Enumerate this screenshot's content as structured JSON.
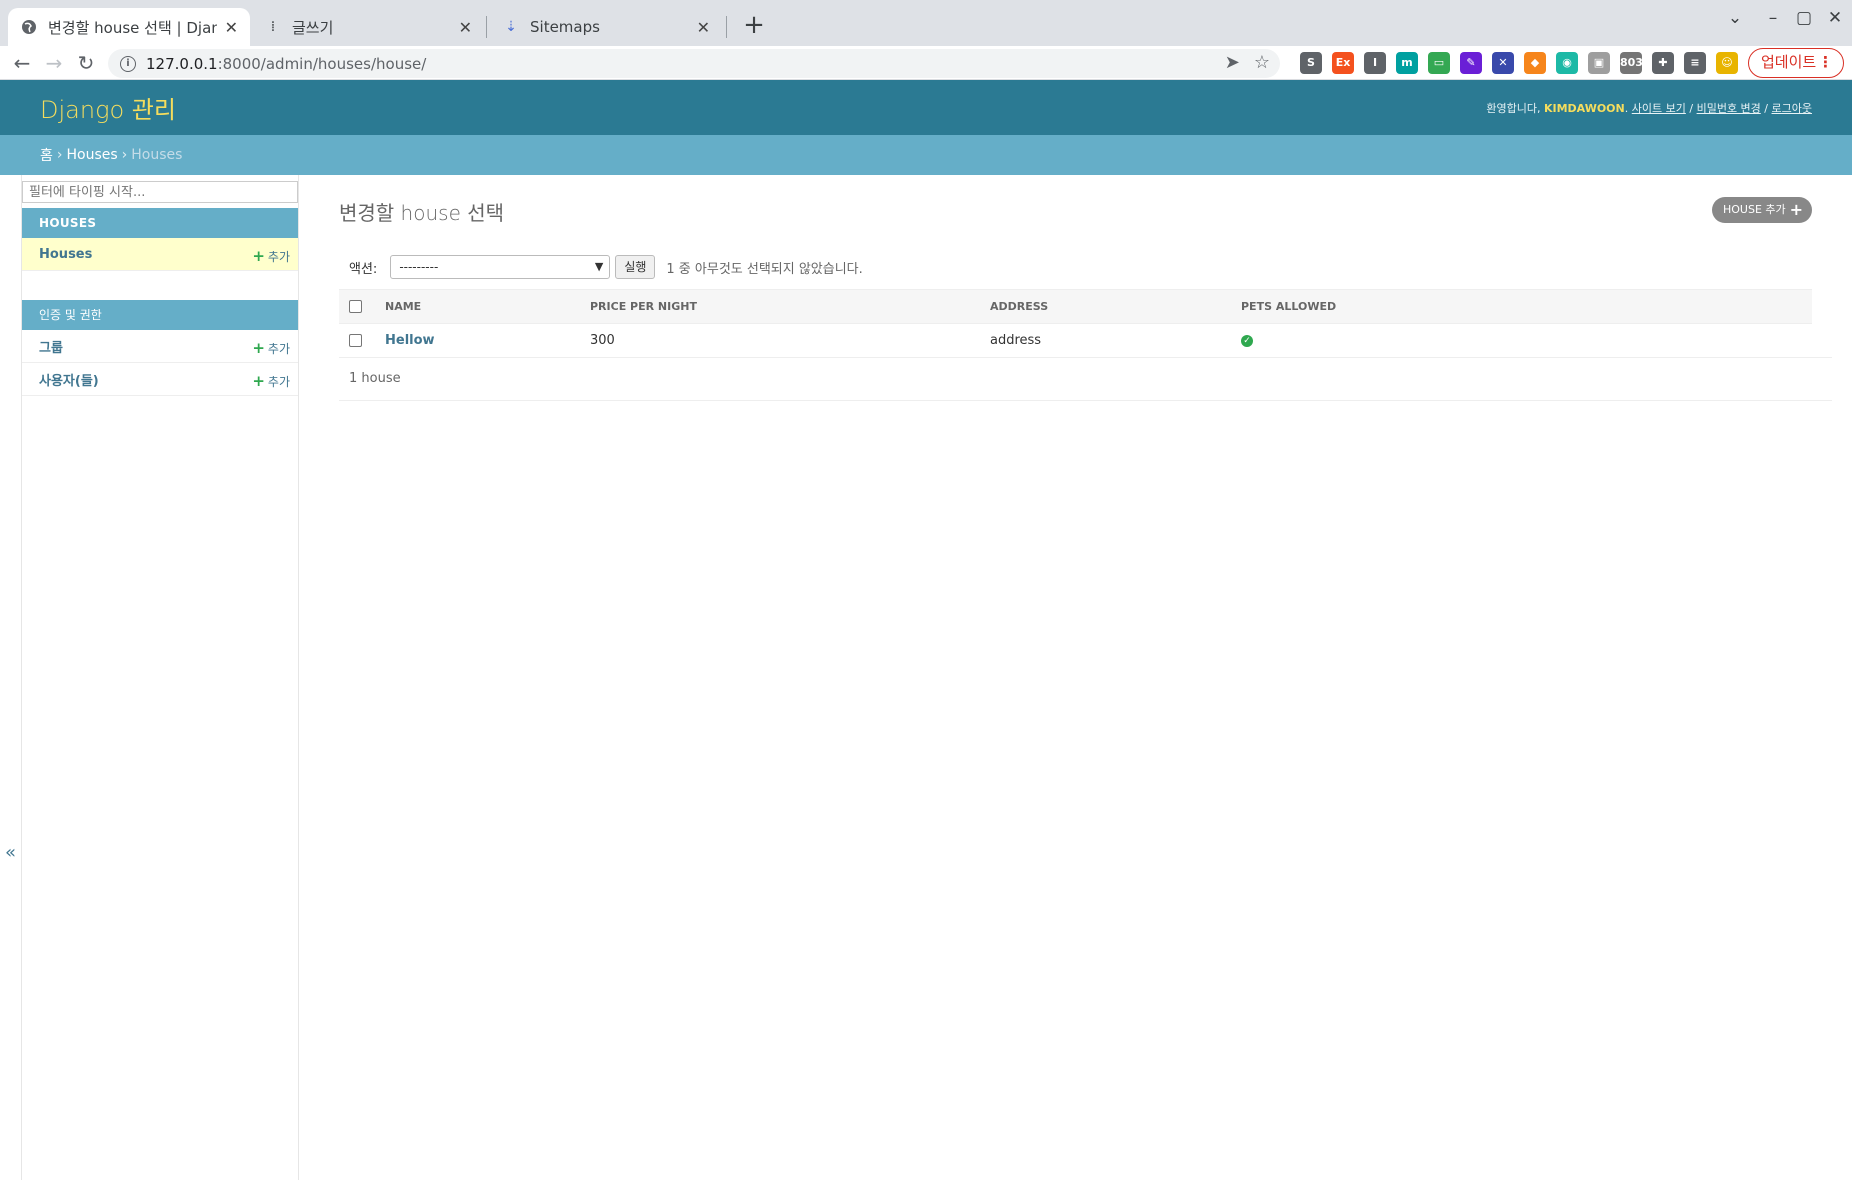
{
  "browser": {
    "tabs": [
      {
        "title": "변경할 house 선택 | Django",
        "active": true
      },
      {
        "title": "글쓰기",
        "active": false
      },
      {
        "title": "Sitemaps",
        "active": false
      }
    ],
    "url_host": "127.0.0.1",
    "url_rest": ":8000/admin/houses/house/",
    "update_label": "업데이트",
    "extensions": [
      {
        "icon": "s-extension-icon",
        "label": "S",
        "color": "#5f6368"
      },
      {
        "icon": "ex-extension-icon",
        "label": "Ex",
        "color": "#f4511e"
      },
      {
        "icon": "i-extension-icon",
        "label": "I",
        "color": "#5f6368"
      },
      {
        "icon": "m-extension-icon",
        "label": "m",
        "color": "#00a0a0"
      },
      {
        "icon": "tv-extension-icon",
        "label": "▭",
        "color": "#34a853"
      },
      {
        "icon": "edit-extension-icon",
        "label": "✎",
        "color": "#6a1fd6"
      },
      {
        "icon": "tool-extension-icon",
        "label": "✕",
        "color": "#3949ab"
      },
      {
        "icon": "fox-extension-icon",
        "label": "◆",
        "color": "#f6851b"
      },
      {
        "icon": "target-extension-icon",
        "label": "◉",
        "color": "#1db9a6"
      },
      {
        "icon": "box-extension-icon",
        "label": "▣",
        "color": "#9e9e9e"
      },
      {
        "icon": "text-extension-icon",
        "label": "803",
        "color": "#757575"
      },
      {
        "icon": "puzzle-icon",
        "label": "✚",
        "color": "#5f6368"
      },
      {
        "icon": "media-icon",
        "label": "≡",
        "color": "#5f6368"
      },
      {
        "icon": "profile-icon",
        "label": "☺",
        "color": "#e8b400"
      }
    ]
  },
  "header": {
    "brand": "Django 관리",
    "welcome": "환영합니다,",
    "username": "KIMDAWOON",
    "sep": "/",
    "view_site": "사이트 보기",
    "change_password": "비밀번호 변경",
    "logout": "로그아웃"
  },
  "breadcrumbs": {
    "home": "홈",
    "app": "Houses",
    "current": "Houses",
    "separator": "›"
  },
  "sidebar": {
    "filter_placeholder": "필터에 타이핑 시작...",
    "collapse": "«",
    "modules": [
      {
        "caption": "HOUSES",
        "models": [
          {
            "name": "Houses",
            "add": "추가"
          }
        ]
      },
      {
        "caption": "인증 및 권한",
        "models": [
          {
            "name": "그룹",
            "add": "추가"
          },
          {
            "name": "사용자(들)",
            "add": "추가"
          }
        ]
      }
    ]
  },
  "content": {
    "title": "변경할 house 선택",
    "add_button": "HOUSE 추가",
    "action_label": "액션:",
    "action_selected": "---------",
    "go_label": "실행",
    "counter": "1 중 아무것도 선택되지 않았습니다.",
    "columns": [
      "NAME",
      "PRICE PER NIGHT",
      "ADDRESS",
      "PETS ALLOWED"
    ],
    "rows": [
      {
        "name": "Hellow",
        "price_per_night": "300",
        "address": "address",
        "pets_allowed": true
      }
    ],
    "paginator": "1 house"
  }
}
